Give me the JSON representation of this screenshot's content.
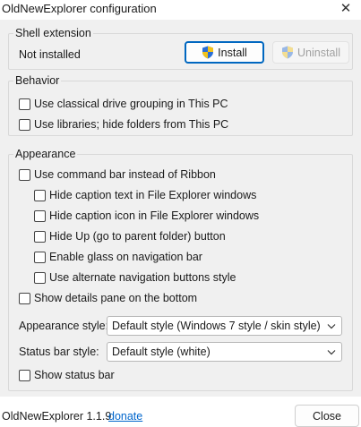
{
  "window": {
    "title": "OldNewExplorer configuration",
    "close_glyph": "✕"
  },
  "shell_extension": {
    "legend": "Shell extension",
    "status": "Not installed",
    "install_label": "Install",
    "uninstall_label": "Uninstall"
  },
  "behavior": {
    "legend": "Behavior",
    "options": [
      {
        "label": "Use classical drive grouping in This PC",
        "checked": false
      },
      {
        "label": "Use libraries; hide folders from This PC",
        "checked": false
      }
    ]
  },
  "appearance": {
    "legend": "Appearance",
    "command_bar": {
      "label": "Use command bar instead of Ribbon",
      "checked": false
    },
    "sub_options": [
      {
        "label": "Hide caption text in File Explorer windows",
        "checked": false
      },
      {
        "label": "Hide caption icon in File Explorer windows",
        "checked": false
      },
      {
        "label": "Hide Up (go to parent folder) button",
        "checked": false
      },
      {
        "label": "Enable glass on navigation bar",
        "checked": false
      },
      {
        "label": "Use alternate navigation buttons style",
        "checked": false
      }
    ],
    "details_pane": {
      "label": "Show details pane on the bottom",
      "checked": false
    },
    "appearance_style": {
      "label": "Appearance style:",
      "value": "Default style (Windows 7 style / skin style)"
    },
    "status_bar_style": {
      "label": "Status bar style:",
      "value": "Default style (white)"
    },
    "show_status_bar": {
      "label": "Show status bar",
      "checked": false
    }
  },
  "footer": {
    "version": "OldNewExplorer 1.1.9",
    "donate_link": "donate",
    "close_label": "Close"
  },
  "colors": {
    "accent": "#0067c0",
    "link": "#0066cc",
    "shield_blue": "#2b6fd6",
    "shield_yellow": "#f3c31a"
  }
}
